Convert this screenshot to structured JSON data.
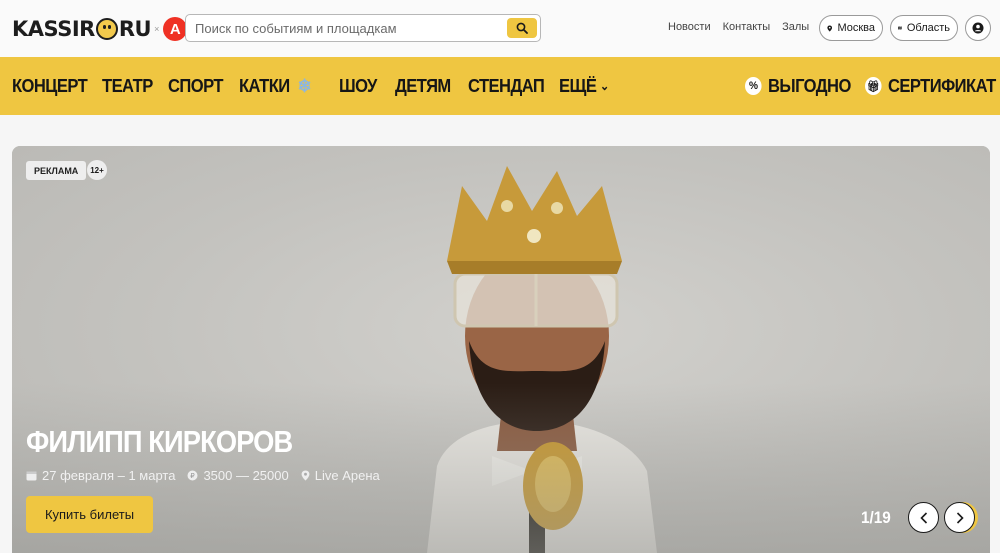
{
  "header": {
    "logo": {
      "text_a": "KASSIR",
      "text_b": "RU",
      "separator": "×",
      "partner_letter": "А"
    },
    "search": {
      "placeholder": "Поиск по событиям и площадкам",
      "value": ""
    },
    "links": [
      "Новости",
      "Контакты",
      "Залы"
    ],
    "city_label": "Москва",
    "region_label": "Область"
  },
  "nav": {
    "items": [
      "КОНЦЕРТ",
      "ТЕАТР",
      "СПОРТ",
      "КАТКИ",
      "ШОУ",
      "ДЕТЯМ",
      "СТЕНДАП",
      "ЕЩЁ"
    ],
    "promo_label": "ВЫГОДНО",
    "certificate_label": "СЕРТИФИКАТ"
  },
  "banner": {
    "ad_label": "РЕКЛАМА",
    "age_label": "12+",
    "title": "ФИЛИПП КИРКОРОВ",
    "date": "27 февраля – 1 марта",
    "price": "3500 — 25000",
    "venue": "Live Арена",
    "buy_label": "Купить билеты",
    "counter": "1/19"
  },
  "colors": {
    "accent": "#efc641",
    "partner": "#ef3124",
    "banner_bg": "#c4c4c0"
  },
  "icons": [
    "search-icon",
    "location-pin-icon",
    "map-icon",
    "user-icon",
    "snowflake-icon",
    "chevron-down-icon",
    "percent-icon",
    "gift-icon",
    "calendar-icon",
    "price-icon",
    "chevron-left-icon",
    "chevron-right-icon"
  ]
}
